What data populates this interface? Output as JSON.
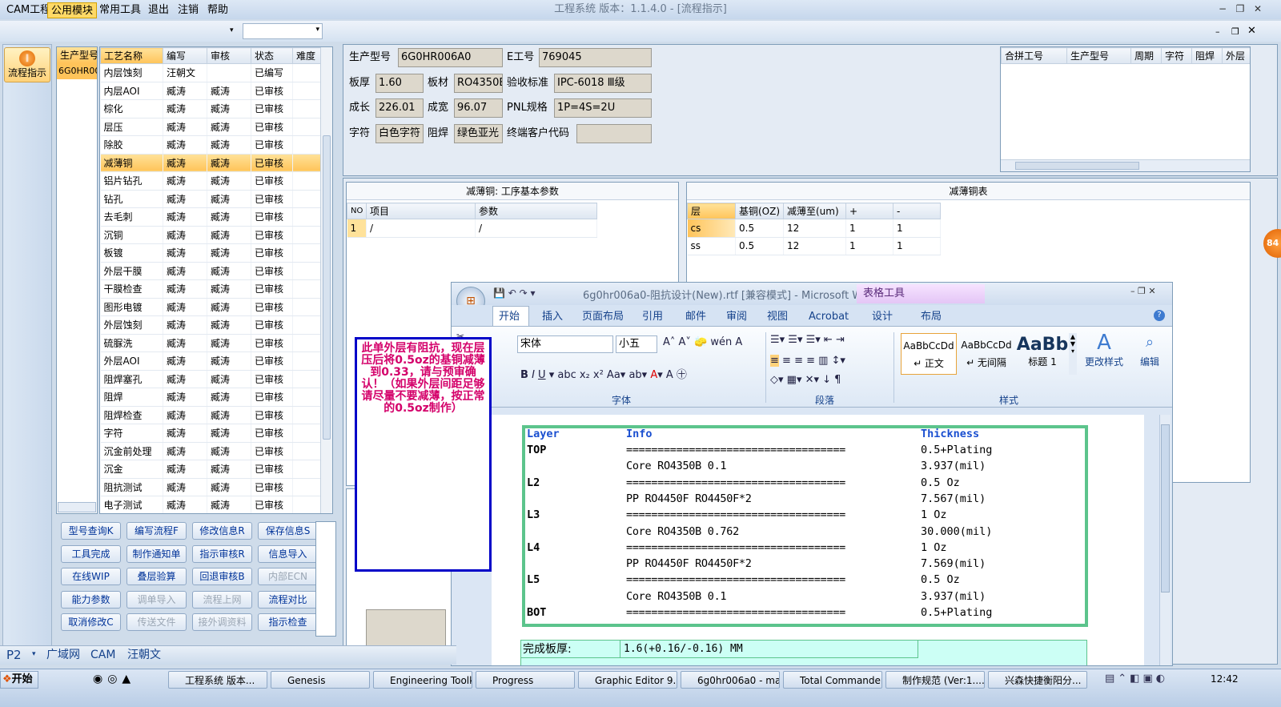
{
  "window": {
    "title": "工程系统  版本：1.1.4.0 - [流程指示]"
  },
  "menu": {
    "items": [
      "CAM工程",
      "公用模块",
      "常用工具",
      "退出",
      "注销",
      "帮助"
    ],
    "active_index": 1
  },
  "nav": {
    "flow_button": "流程指示"
  },
  "model_list": {
    "header": "生产型号",
    "items": [
      "6G0HR00"
    ]
  },
  "process": {
    "headers": [
      "工艺名称",
      "编写",
      "审核",
      "状态",
      "难度"
    ],
    "rows": [
      [
        "内层蚀刻",
        "汪朝文",
        "",
        "已编写"
      ],
      [
        "内层AOI",
        "臧涛",
        "臧涛",
        "已审核"
      ],
      [
        "棕化",
        "臧涛",
        "臧涛",
        "已审核"
      ],
      [
        "层压",
        "臧涛",
        "臧涛",
        "已审核"
      ],
      [
        "除胶",
        "臧涛",
        "臧涛",
        "已审核"
      ],
      [
        "减薄铜",
        "臧涛",
        "臧涛",
        "已审核"
      ],
      [
        "铝片钻孔",
        "臧涛",
        "臧涛",
        "已审核"
      ],
      [
        "钻孔",
        "臧涛",
        "臧涛",
        "已审核"
      ],
      [
        "去毛刺",
        "臧涛",
        "臧涛",
        "已审核"
      ],
      [
        "沉铜",
        "臧涛",
        "臧涛",
        "已审核"
      ],
      [
        "板镀",
        "臧涛",
        "臧涛",
        "已审核"
      ],
      [
        "外层干膜",
        "臧涛",
        "臧涛",
        "已审核"
      ],
      [
        "干膜检查",
        "臧涛",
        "臧涛",
        "已审核"
      ],
      [
        "图形电镀",
        "臧涛",
        "臧涛",
        "已审核"
      ],
      [
        "外层蚀刻",
        "臧涛",
        "臧涛",
        "已审核"
      ],
      [
        "硫脲洗",
        "臧涛",
        "臧涛",
        "已审核"
      ],
      [
        "外层AOI",
        "臧涛",
        "臧涛",
        "已审核"
      ],
      [
        "阻焊塞孔",
        "臧涛",
        "臧涛",
        "已审核"
      ],
      [
        "阻焊",
        "臧涛",
        "臧涛",
        "已审核"
      ],
      [
        "阻焊检查",
        "臧涛",
        "臧涛",
        "已审核"
      ],
      [
        "字符",
        "臧涛",
        "臧涛",
        "已审核"
      ],
      [
        "沉金前处理",
        "臧涛",
        "臧涛",
        "已审核"
      ],
      [
        "沉金",
        "臧涛",
        "臧涛",
        "已审核"
      ],
      [
        "阻抗测试",
        "臧涛",
        "臧涛",
        "已审核"
      ],
      [
        "电子测试",
        "臧涛",
        "臧涛",
        "已审核"
      ]
    ],
    "selected_index": 5
  },
  "actions": [
    {
      "label": "型号查询K",
      "enabled": true
    },
    {
      "label": "编写流程F",
      "enabled": true
    },
    {
      "label": "修改信息R",
      "enabled": true
    },
    {
      "label": "保存信息S",
      "enabled": true
    },
    {
      "label": "工具完成",
      "enabled": true
    },
    {
      "label": "制作通知单",
      "enabled": true
    },
    {
      "label": "指示审核R",
      "enabled": true
    },
    {
      "label": "信息导入",
      "enabled": true
    },
    {
      "label": "在线WIP",
      "enabled": true
    },
    {
      "label": "叠层验算",
      "enabled": true
    },
    {
      "label": "回退审核B",
      "enabled": true
    },
    {
      "label": "内部ECN",
      "enabled": false
    },
    {
      "label": "能力参数",
      "enabled": true
    },
    {
      "label": "调单导入",
      "enabled": false
    },
    {
      "label": "流程上网",
      "enabled": false
    },
    {
      "label": "流程对比",
      "enabled": true
    },
    {
      "label": "取消修改C",
      "enabled": true
    },
    {
      "label": "传送文件",
      "enabled": false
    },
    {
      "label": "接外调资料",
      "enabled": false
    },
    {
      "label": "指示检查",
      "enabled": true
    }
  ],
  "info": {
    "model_label": "生产型号",
    "model": "6G0HR006A0",
    "eno_label": "E工号",
    "eno": "769045",
    "thick_label": "板厚",
    "thick": "1.60",
    "mat_label": "板材",
    "mat": "RO4350B",
    "accept_label": "验收标准",
    "accept": "IPC-6018 Ⅲ级",
    "len_label": "成长",
    "len": "226.01",
    "wid_label": "成宽",
    "wid": "96.07",
    "pnl_label": "PNL规格",
    "pnl": "1P=4S=2U",
    "char_label": "字符",
    "char": "白色字符",
    "mask_label": "阻焊",
    "mask": "绿色亚光",
    "cust_label": "终端客户代码",
    "cust": ""
  },
  "merge_table": {
    "headers": [
      "合拼工号",
      "生产型号",
      "周期",
      "字符",
      "阻焊",
      "外层"
    ]
  },
  "params": {
    "title": "减薄铜: 工序基本参数",
    "headers": [
      "NO",
      "项目",
      "参数"
    ],
    "rows": [
      [
        "1",
        "/",
        "/"
      ]
    ]
  },
  "thin_table": {
    "title": "减薄铜表",
    "headers": [
      "层",
      "基铜(OZ)",
      "减薄至(um)",
      "+",
      "-"
    ],
    "rows": [
      [
        "cs",
        "0.5",
        "12",
        "1",
        "1"
      ],
      [
        "ss",
        "0.5",
        "12",
        "1",
        "1"
      ]
    ]
  },
  "note": {
    "text": "此单外层有阻抗，现在层压后将0.5oz的基铜减薄到0.33，请与预审确认！（如果外层间距足够请尽量不要减薄，按正常的0.5oz制作）"
  },
  "word": {
    "title": "6g0hr006a0-阻抗设计(New).rtf [兼容模式] - Microsoft Wo...",
    "context_tab": "表格工具",
    "tabs": [
      "开始",
      "插入",
      "页面布局",
      "引用",
      "邮件",
      "审阅",
      "视图",
      "Acrobat",
      "设计",
      "布局"
    ],
    "font_name": "宋体",
    "font_size": "小五",
    "groups": [
      "字体",
      "段落",
      "样式"
    ],
    "styles": [
      {
        "preview": "AaBbCcDd",
        "name": "↵ 正文"
      },
      {
        "preview": "AaBbCcDd",
        "name": "↵ 无间隔"
      },
      {
        "preview": "AaBb",
        "name": "标题 1"
      }
    ],
    "change_style": "更改样式",
    "edit": "编辑",
    "stack_header": [
      "Layer",
      "Info",
      "Thickness"
    ],
    "stack_rows": [
      {
        "layer": "TOP",
        "info": "===================================",
        "thick": "0.5+Plating"
      },
      {
        "layer": "",
        "info": "Core     RO4350B    0.1",
        "thick": "3.937(mil)"
      },
      {
        "layer": "L2",
        "info": "===================================",
        "thick": "0.5 Oz"
      },
      {
        "layer": "",
        "info": "PP     RO4450F    RO4450F*2",
        "thick": "7.567(mil)"
      },
      {
        "layer": "L3",
        "info": "===================================",
        "thick": "1 Oz"
      },
      {
        "layer": "",
        "info": "Core     RO4350B    0.762",
        "thick": "30.000(mil)"
      },
      {
        "layer": "L4",
        "info": "===================================",
        "thick": "1 Oz"
      },
      {
        "layer": "",
        "info": "PP     RO4450F    RO4450F*2",
        "thick": "7.569(mil)"
      },
      {
        "layer": "L5",
        "info": "===================================",
        "thick": "0.5 Oz"
      },
      {
        "layer": "",
        "info": "Core     RO4350B    0.1",
        "thick": "3.937(mil)"
      },
      {
        "layer": "BOT",
        "info": "===================================",
        "thick": "0.5+Plating"
      }
    ],
    "finish_label": "完成板厚:",
    "finish_value": "1.6(+0.16/-0.16) MM"
  },
  "statusbar": {
    "p": "P2",
    "items": [
      "广域网",
      "CAM",
      "汪朝文"
    ]
  },
  "badge": "84",
  "taskbar": {
    "start": "开始",
    "tasks": [
      "工程系统  版本...",
      "Genesis",
      "Engineering Toolki...",
      "Progress",
      "Graphic Editor 9.0...",
      "6g0hr006a0 - mai...",
      "Total Commander ...",
      "制作规范 (Ver:1....",
      "兴森快捷衡阳分..."
    ],
    "clock": "12:42"
  },
  "colors": {
    "accent": "#ffc45a",
    "note_border": "#0000c8",
    "note_text": "#d4006a",
    "stack_border": "#5cc48c",
    "stack_header": "#1a4fd0"
  }
}
